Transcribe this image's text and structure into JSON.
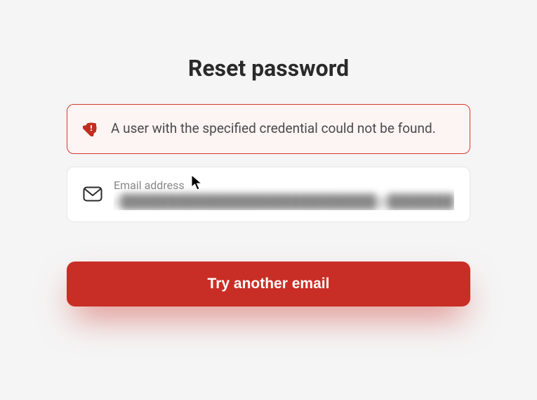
{
  "title": "Reset password",
  "alert": {
    "message": "A user with the specified credential could not be found."
  },
  "email": {
    "label": "Email address",
    "value": "c███████████████████████████@██████████████"
  },
  "button": {
    "label": "Try another email"
  },
  "colors": {
    "accent": "#c92e26",
    "alertBorder": "#d43a32",
    "alertBg": "#fdf4f4"
  }
}
